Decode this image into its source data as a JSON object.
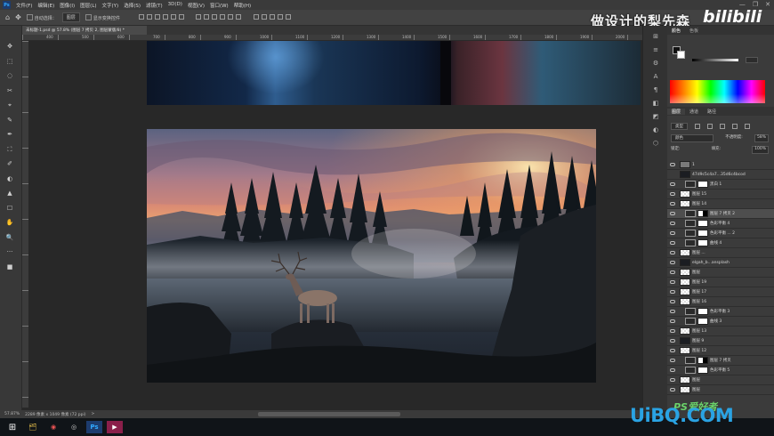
{
  "menubar": {
    "logo": "Ps",
    "items": [
      "文件(F)",
      "编辑(E)",
      "图像(I)",
      "图层(L)",
      "文字(Y)",
      "选择(S)",
      "滤镜(T)",
      "3D(D)",
      "视图(V)",
      "窗口(W)",
      "帮助(H)"
    ],
    "window_controls": [
      "—",
      "❐",
      "✕"
    ]
  },
  "options_bar": {
    "home_icon": "⌂",
    "move_icon": "✥",
    "auto_select": "自动选择：",
    "auto_select_target": "图层",
    "show_transform": "显示变换控件"
  },
  "watermark": {
    "channel": "做设计的梨先森",
    "brand": "bilibili"
  },
  "document_tab": {
    "label": "未标题-1.psd @ 57.8% (图层 7 拷贝 2, 图层蒙版/8) *",
    "close": "×"
  },
  "ruler": {
    "labels": [
      "400",
      "500",
      "600",
      "700",
      "800",
      "900",
      "1000",
      "1100",
      "1200",
      "1300",
      "1400",
      "1500",
      "1600",
      "1700",
      "1800",
      "1900",
      "2000"
    ]
  },
  "tools": [
    "✥",
    "⬚",
    "◌",
    "✂",
    "⌖",
    "✎",
    "✒",
    "⛶",
    "✐",
    "◐",
    "▲",
    "☐",
    "✋",
    "🔍",
    "···",
    "■"
  ],
  "status_bar": {
    "zoom": "57.87%",
    "info": "2289 像素 x 1049 像素 (72 ppi)",
    "arrow": ">"
  },
  "right_strip_icons": [
    "⊞",
    "≡",
    "⚙",
    "A",
    "¶",
    "◧",
    "◩",
    "◐",
    "⬡"
  ],
  "color_panel": {
    "tabs": [
      "颜色",
      "色板"
    ],
    "fg_color": "#111111",
    "bg_color": "#ffffff"
  },
  "layers_panel": {
    "tabs": [
      "图层",
      "通道",
      "路径"
    ],
    "filter_kind": "类型",
    "blend_mode": "颜色",
    "opacity_label": "不透明度:",
    "opacity": "58%",
    "lock_label": "锁定:",
    "fill_label": "填充:",
    "fill": "100%",
    "layers": [
      {
        "name": "1",
        "type": "group",
        "visible": true,
        "selected": false
      },
      {
        "name": "47d9c5c4a7...35d6c4bcod",
        "type": "dark",
        "visible": false,
        "selected": false
      },
      {
        "name": "黑白 1",
        "type": "adj",
        "visible": true,
        "selected": false
      },
      {
        "name": "图层 15",
        "type": "layer",
        "visible": true,
        "selected": false
      },
      {
        "name": "图层 14",
        "type": "layer",
        "visible": true,
        "selected": false
      },
      {
        "name": "图层 7 拷贝 2",
        "type": "mask",
        "visible": true,
        "selected": true
      },
      {
        "name": "色彩平衡 4",
        "type": "adj",
        "visible": true,
        "selected": false
      },
      {
        "name": "色彩平衡 ... 2",
        "type": "adj",
        "visible": true,
        "selected": false
      },
      {
        "name": "曲线 4",
        "type": "adj",
        "visible": true,
        "selected": false
      },
      {
        "name": "图层 ...",
        "type": "layer",
        "visible": true,
        "selected": false
      },
      {
        "name": "elgah_b...ansplash",
        "type": "dark",
        "visible": true,
        "selected": false
      },
      {
        "name": "图层",
        "type": "layer",
        "visible": true,
        "selected": false
      },
      {
        "name": "图层 19",
        "type": "layer",
        "visible": true,
        "selected": false
      },
      {
        "name": "图层 17",
        "type": "layer",
        "visible": true,
        "selected": false
      },
      {
        "name": "图层 16",
        "type": "layer",
        "visible": true,
        "selected": false
      },
      {
        "name": "色彩平衡 3",
        "type": "adj",
        "visible": true,
        "selected": false
      },
      {
        "name": "曲线 3",
        "type": "adj",
        "visible": true,
        "selected": false
      },
      {
        "name": "图层 13",
        "type": "layer",
        "visible": true,
        "selected": false
      },
      {
        "name": "图层 9",
        "type": "dark",
        "visible": true,
        "selected": false
      },
      {
        "name": "图层 12",
        "type": "layer",
        "visible": true,
        "selected": false
      },
      {
        "name": "图层 7 拷贝",
        "type": "mask",
        "visible": true,
        "selected": false
      },
      {
        "name": "色彩平衡 5",
        "type": "adj",
        "visible": true,
        "selected": false
      },
      {
        "name": "图层",
        "type": "layer",
        "visible": true,
        "selected": false
      },
      {
        "name": "图层",
        "type": "layer",
        "visible": true,
        "selected": false
      }
    ]
  },
  "taskbar": {
    "start": "⊞",
    "apps": [
      "🗂",
      "◉",
      "◎",
      "Ps",
      "▶"
    ]
  },
  "site_watermark": {
    "logo": "UiBQ.COM",
    "cn": "PS爱好者"
  }
}
